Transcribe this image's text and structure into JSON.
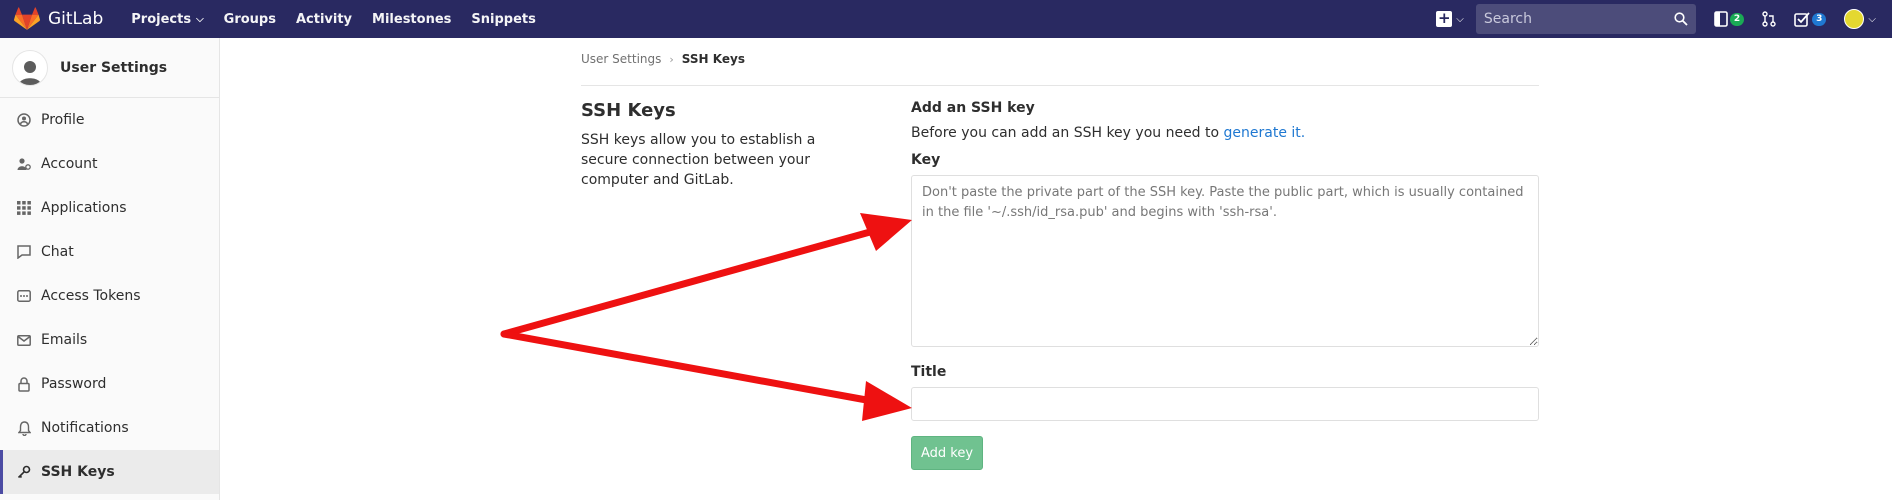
{
  "navbar": {
    "brand": "GitLab",
    "links": [
      "Projects",
      "Groups",
      "Activity",
      "Milestones",
      "Snippets"
    ],
    "search_placeholder": "Search",
    "issues_count": "2",
    "todos_count": "3"
  },
  "sidebar": {
    "title": "User Settings",
    "items": [
      {
        "label": "Profile",
        "icon": "profile-icon"
      },
      {
        "label": "Account",
        "icon": "account-icon"
      },
      {
        "label": "Applications",
        "icon": "applications-icon"
      },
      {
        "label": "Chat",
        "icon": "chat-icon"
      },
      {
        "label": "Access Tokens",
        "icon": "token-icon"
      },
      {
        "label": "Emails",
        "icon": "email-icon"
      },
      {
        "label": "Password",
        "icon": "lock-icon"
      },
      {
        "label": "Notifications",
        "icon": "bell-icon"
      },
      {
        "label": "SSH Keys",
        "icon": "key-icon"
      }
    ]
  },
  "breadcrumb": {
    "parent": "User Settings",
    "current": "SSH Keys"
  },
  "info": {
    "title": "SSH Keys",
    "description": "SSH keys allow you to establish a secure connection between your computer and GitLab."
  },
  "form": {
    "heading": "Add an SSH key",
    "intro_text": "Before you can add an SSH key you need to ",
    "intro_link": "generate it.",
    "key_label": "Key",
    "key_placeholder": "Don't paste the private part of the SSH key. Paste the public part, which is usually contained in the file '~/.ssh/id_rsa.pub' and begins with 'ssh-rsa'.",
    "title_label": "Title",
    "title_value": "",
    "submit_label": "Add key"
  },
  "colors": {
    "navbar": "#292961",
    "accent": "#4b4ba3",
    "link": "#1f78d1",
    "button": "#70c290",
    "annotation": "#ee1111"
  }
}
